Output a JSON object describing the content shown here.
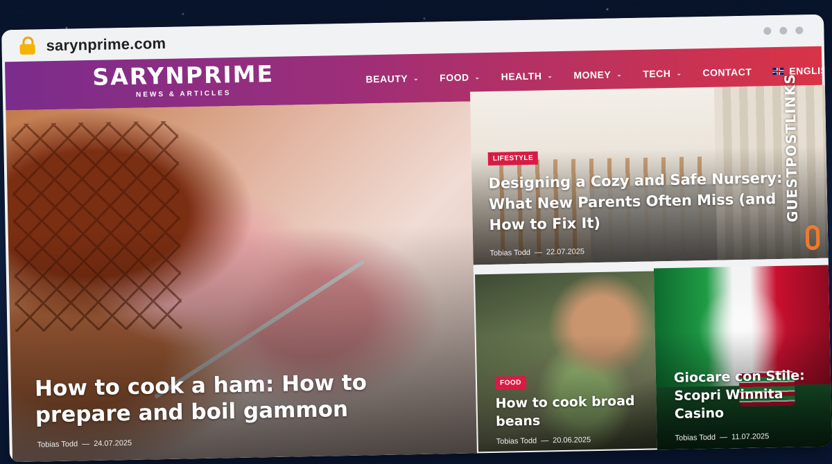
{
  "browser": {
    "url": "sarynprime.com",
    "accent": "#f5b400"
  },
  "site": {
    "logo_name": "SARYNPRIME",
    "logo_tagline": "NEWS & ARTICLES",
    "header_gradient": [
      "#7b2c8c",
      "#d93346"
    ],
    "nav": [
      {
        "label": "BEAUTY",
        "has_dropdown": true
      },
      {
        "label": "FOOD",
        "has_dropdown": true
      },
      {
        "label": "HEALTH",
        "has_dropdown": true
      },
      {
        "label": "MONEY",
        "has_dropdown": true
      },
      {
        "label": "TECH",
        "has_dropdown": true
      },
      {
        "label": "CONTACT",
        "has_dropdown": false
      },
      {
        "label": "ENGLISH",
        "has_dropdown": false,
        "icon": "uk-flag-icon"
      }
    ]
  },
  "articles": [
    {
      "title": "How to cook a ham: How to prepare and boil gammon",
      "author": "Tobias Todd",
      "date": "24.07.2025",
      "category": ""
    },
    {
      "title": "Designing a Cozy and Safe Nursery: What New Parents Often Miss (and How to Fix It)",
      "author": "Tobias Todd",
      "date": "22.07.2025",
      "category": "LIFESTYLE",
      "category_color": "#d81b45"
    },
    {
      "title": "How to cook broad beans",
      "author": "Tobias Todd",
      "date": "20.06.2025",
      "category": "FOOD",
      "category_color": "#d81b45"
    },
    {
      "title": "Giocare con Stile: Scopri Winnita Casino",
      "author": "Tobias Todd",
      "date": "11.07.2025",
      "category": ""
    }
  ],
  "meta_separator": "—",
  "watermark": {
    "text": "GUESTPOSTLINKS",
    "icon": "link-icon",
    "color": "#f07a2a"
  }
}
